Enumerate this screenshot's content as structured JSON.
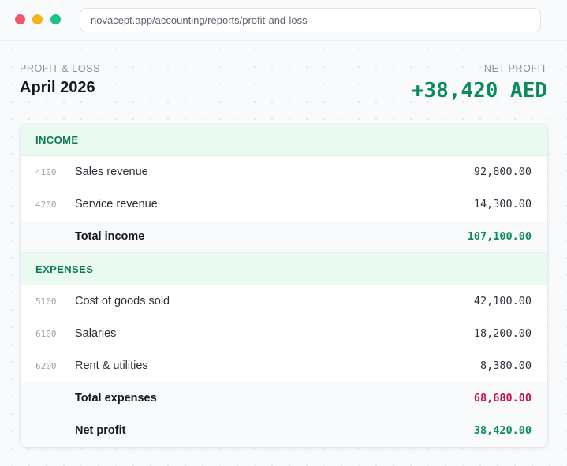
{
  "browser": {
    "url": "novacept.app/accounting/reports/profit-and-loss"
  },
  "report": {
    "eyebrow": "PROFIT & LOSS",
    "period": "April 2026",
    "net_label": "NET PROFIT",
    "net_value": "+38,420 AED"
  },
  "income": {
    "heading": "INCOME",
    "rows": [
      {
        "code": "4100",
        "label": "Sales revenue",
        "amount": "92,800.00"
      },
      {
        "code": "4200",
        "label": "Service revenue",
        "amount": "14,300.00"
      }
    ],
    "total_label": "Total income",
    "total_amount": "107,100.00"
  },
  "expenses": {
    "heading": "EXPENSES",
    "rows": [
      {
        "code": "5100",
        "label": "Cost of goods sold",
        "amount": "42,100.00"
      },
      {
        "code": "6100",
        "label": "Salaries",
        "amount": "18,200.00"
      },
      {
        "code": "6200",
        "label": "Rent & utilities",
        "amount": "8,380.00"
      }
    ],
    "total_label": "Total expenses",
    "total_amount": "68,680.00"
  },
  "net": {
    "label": "Net profit",
    "amount": "38,420.00"
  },
  "colors": {
    "accent_green": "#0b8a5c",
    "expense_red": "#c0154a",
    "section_bg": "#ebfaf1"
  }
}
